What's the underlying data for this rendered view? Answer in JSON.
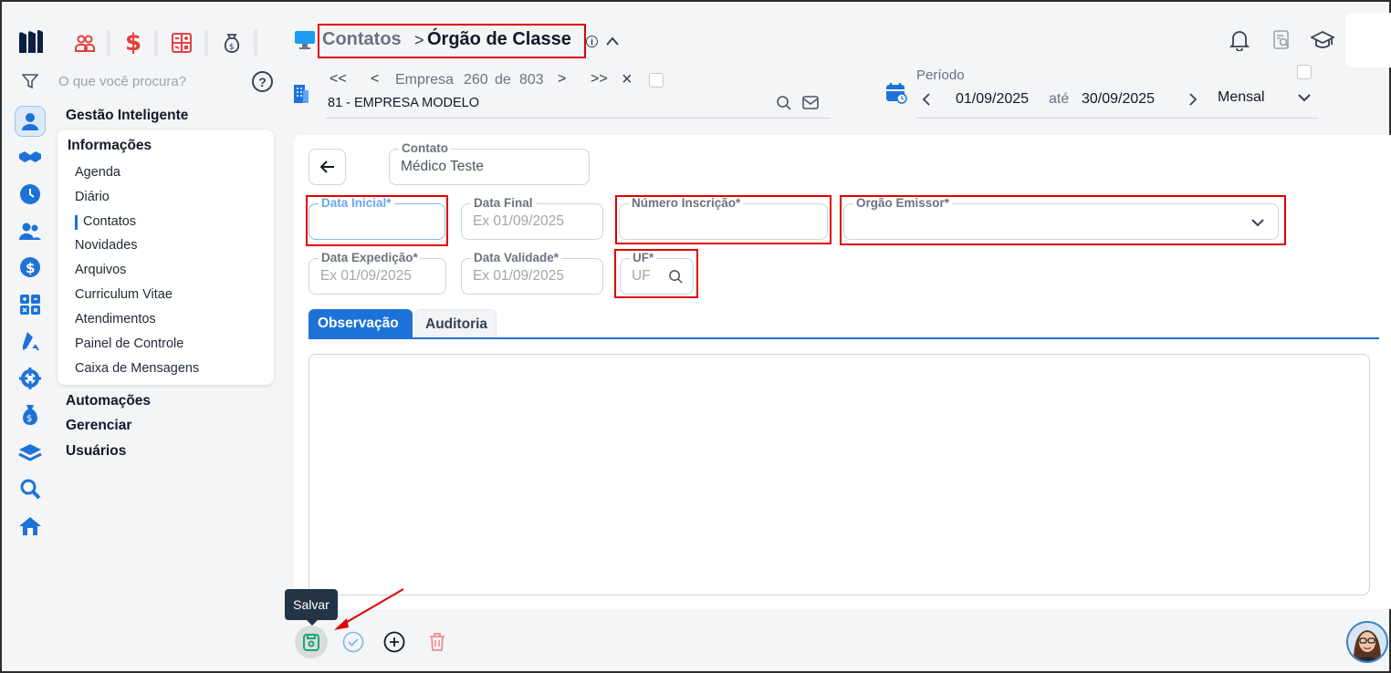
{
  "brand": {
    "logo_text": "M"
  },
  "modules": [
    {
      "icon": "people-icon",
      "color": "#e53e3e"
    },
    {
      "icon": "dollar-icon",
      "color": "#e53e3e"
    },
    {
      "icon": "calculator-icon",
      "color": "#e53e3e"
    },
    {
      "icon": "money-bag-icon",
      "color": "#374151"
    }
  ],
  "search": {
    "placeholder": "O que você procura?",
    "help": "?"
  },
  "rail": [
    "contacts-card-icon",
    "handshake-icon",
    "clock-icon",
    "users-icon",
    "dollar-circle-icon",
    "calculator-icon",
    "pen-icon",
    "settings-gear-icon",
    "money-bag-icon",
    "layers-icon",
    "magnifier-icon",
    "home-icon"
  ],
  "sidebar": {
    "section_main": "Gestão Inteligente",
    "card_title": "Informações",
    "items": [
      {
        "label": "Agenda"
      },
      {
        "label": "Diário"
      },
      {
        "label": "Contatos",
        "active": true
      },
      {
        "label": "Novidades"
      },
      {
        "label": "Arquivos"
      },
      {
        "label": "Curriculum Vitae"
      },
      {
        "label": "Atendimentos"
      },
      {
        "label": "Painel de Controle"
      },
      {
        "label": "Caixa de Mensagens"
      }
    ],
    "sections_after": [
      "Automações",
      "Gerenciar",
      "Usuários"
    ]
  },
  "header": {
    "breadcrumb": "Contatos",
    "separator": ">",
    "title": "Órgão de Classe",
    "info": "i"
  },
  "company_nav": {
    "first": "<<",
    "prev": "<",
    "label": "Empresa",
    "current": "260",
    "of": "de",
    "total": "803",
    "next": ">",
    "last": ">>",
    "close": "×",
    "company": "81 - EMPRESA MODELO"
  },
  "period": {
    "label": "Período",
    "start": "01/09/2025",
    "until": "até",
    "end": "30/09/2025",
    "mode": "Mensal"
  },
  "form": {
    "contato": {
      "label": "Contato",
      "value": "Médico Teste"
    },
    "data_inicial": {
      "label": "Data Inicial*",
      "value": ""
    },
    "data_final": {
      "label": "Data Final",
      "placeholder": "Ex 01/09/2025"
    },
    "numero_inscricao": {
      "label": "Número Inscrição*",
      "value": ""
    },
    "orgao_emissor": {
      "label": "Orgão Emissor*",
      "value": ""
    },
    "data_expedicao": {
      "label": "Data Expedição*",
      "placeholder": "Ex 01/09/2025"
    },
    "data_validade": {
      "label": "Data Validade*",
      "placeholder": "Ex 01/09/2025"
    },
    "uf": {
      "label": "UF*",
      "placeholder": "UF"
    }
  },
  "tabs": [
    {
      "label": "Observação",
      "active": true
    },
    {
      "label": "Auditoria",
      "active": false
    }
  ],
  "toolbar": {
    "tooltip": "Salvar",
    "buttons": [
      "save-icon",
      "check-icon",
      "add-icon",
      "trash-icon"
    ]
  },
  "colors": {
    "accent": "#1d72d8",
    "highlight_red": "#e00000",
    "save_green": "#1aa67a",
    "delete_red": "#f08a8a"
  }
}
